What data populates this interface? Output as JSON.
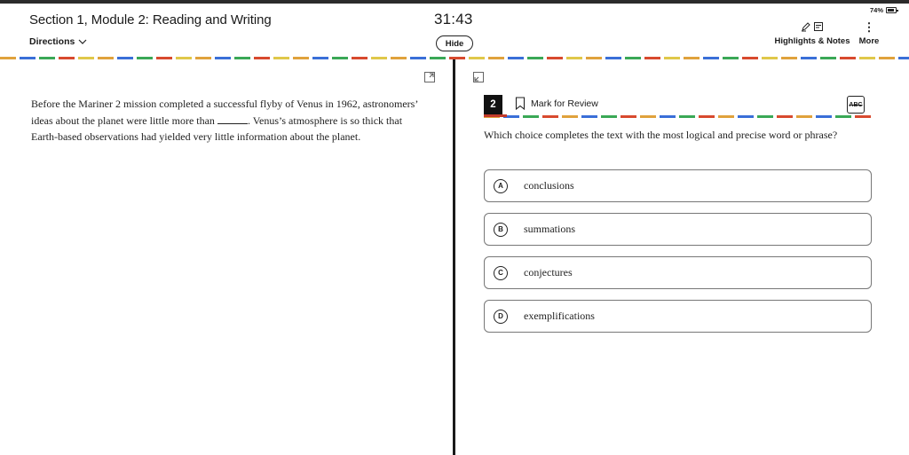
{
  "header": {
    "section_title": "Section 1, Module 2: Reading and Writing",
    "directions_label": "Directions",
    "timer": "31:43",
    "hide_label": "Hide",
    "battery_percent": "74%",
    "highlights_label": "Highlights & Notes",
    "more_label": "More"
  },
  "passage": {
    "before_blank": "Before the Mariner 2 mission completed a successful flyby of Venus in 1962, astronomers’ ideas about the planet were little more than ",
    "after_blank": ". Venus’s atmosphere is so thick that Earth-based observations had yielded very little information about the planet."
  },
  "question": {
    "number": "2",
    "mark_for_review": "Mark for Review",
    "abc_label": "ABC",
    "prompt": "Which choice completes the text with the most logical and precise word or phrase?",
    "choices": [
      {
        "letter": "A",
        "text": "conclusions"
      },
      {
        "letter": "B",
        "text": "summations"
      },
      {
        "letter": "C",
        "text": "conjectures"
      },
      {
        "letter": "D",
        "text": "exemplifications"
      }
    ]
  },
  "icons": {
    "directions": "chevron-down-icon",
    "highlights": "pen-icon",
    "notes": "note-icon",
    "more": "vertical-dots-icon",
    "bookmark": "bookmark-icon",
    "expand": "expand-icon",
    "strike": "strikethrough-abc-icon"
  }
}
